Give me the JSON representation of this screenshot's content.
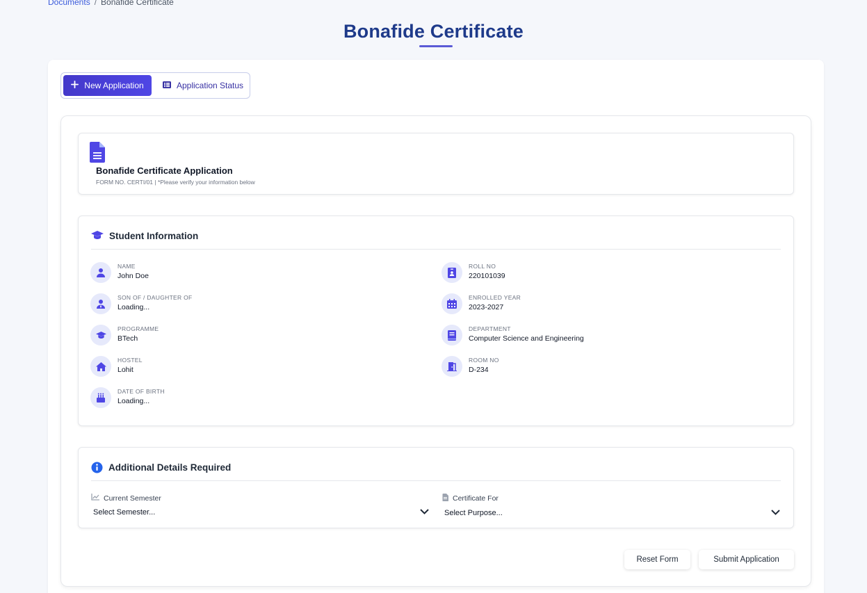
{
  "breadcrumb": {
    "parent": "Documents",
    "separator": "/",
    "current": "Bonafide Certificate"
  },
  "page": {
    "title": "Bonafide Certificate"
  },
  "tabs": {
    "new_application": "New Application",
    "application_status": "Application Status"
  },
  "form_header": {
    "title": "Bonafide Certificate Application",
    "subtitle": "FORM NO. CERTI/01 | *Please verify your information below",
    "icon": "document-icon"
  },
  "student_info": {
    "title": "Student Information",
    "items": [
      {
        "label": "NAME",
        "value": "John Doe",
        "icon": "user-icon"
      },
      {
        "label": "ROLL NO",
        "value": "220101039",
        "icon": "id-badge-icon"
      },
      {
        "label": "SON OF / DAUGHTER OF",
        "value": "Loading...",
        "icon": "user-tie-icon"
      },
      {
        "label": "ENROLLED YEAR",
        "value": "2023-2027",
        "icon": "calendar-icon"
      },
      {
        "label": "PROGRAMME",
        "value": "BTech",
        "icon": "graduation-cap-icon"
      },
      {
        "label": "DEPARTMENT",
        "value": "Computer Science and Engineering",
        "icon": "book-icon"
      },
      {
        "label": "HOSTEL",
        "value": "Lohit",
        "icon": "home-icon"
      },
      {
        "label": "ROOM NO",
        "value": "D-234",
        "icon": "door-icon"
      },
      {
        "label": "DATE OF BIRTH",
        "value": "Loading...",
        "icon": "birthday-cake-icon"
      }
    ]
  },
  "additional": {
    "title": "Additional Details Required",
    "semester_label": "Current Semester",
    "semester_value": "Select Semester...",
    "purpose_label": "Certificate For",
    "purpose_value": "Select Purpose..."
  },
  "buttons": {
    "reset": "Reset Form",
    "submit": "Submit Application"
  },
  "colors": {
    "primary": "#4338ca",
    "title": "#1e3a8a",
    "icon_bg": "#e6e9fb",
    "icon_fg": "#4f46e5"
  }
}
